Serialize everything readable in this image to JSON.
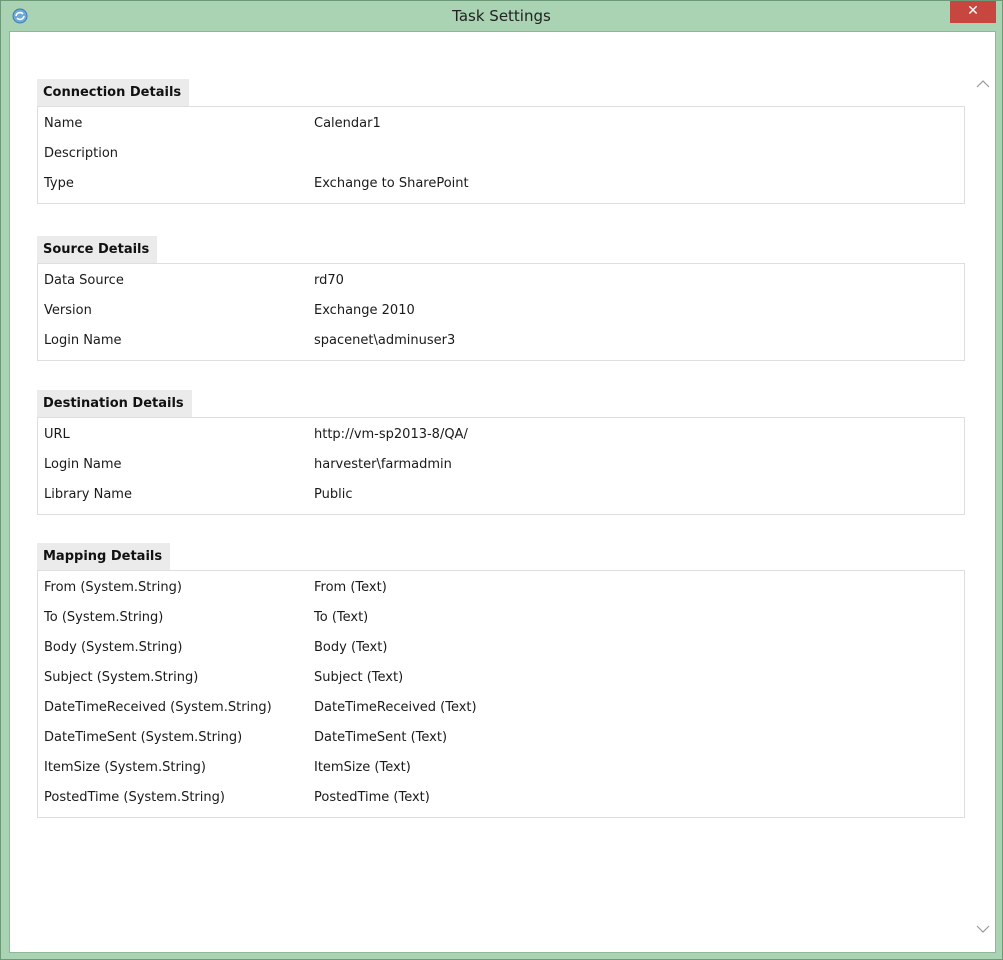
{
  "window": {
    "title": "Task Settings",
    "close_label": "✕"
  },
  "sections": {
    "connection": {
      "title": "Connection Details",
      "rows": [
        {
          "key": "Name",
          "value": "Calendar1"
        },
        {
          "key": "Description",
          "value": ""
        },
        {
          "key": "Type",
          "value": "Exchange to SharePoint"
        }
      ]
    },
    "source": {
      "title": "Source Details",
      "rows": [
        {
          "key": "Data Source",
          "value": "rd70"
        },
        {
          "key": "Version",
          "value": "Exchange 2010"
        },
        {
          "key": "Login Name",
          "value": "spacenet\\adminuser3"
        }
      ]
    },
    "destination": {
      "title": "Destination Details",
      "rows": [
        {
          "key": "URL",
          "value": "http://vm-sp2013-8/QA/"
        },
        {
          "key": "Login Name",
          "value": "harvester\\farmadmin"
        },
        {
          "key": "Library Name",
          "value": "Public"
        }
      ]
    },
    "mapping": {
      "title": "Mapping Details",
      "rows": [
        {
          "key": "From (System.String)",
          "value": "From (Text)"
        },
        {
          "key": "To (System.String)",
          "value": "To (Text)"
        },
        {
          "key": "Body (System.String)",
          "value": "Body (Text)"
        },
        {
          "key": "Subject (System.String)",
          "value": "Subject (Text)"
        },
        {
          "key": "DateTimeReceived (System.String)",
          "value": "DateTimeReceived (Text)"
        },
        {
          "key": "DateTimeSent (System.String)",
          "value": "DateTimeSent (Text)"
        },
        {
          "key": "ItemSize (System.String)",
          "value": "ItemSize (Text)"
        },
        {
          "key": "PostedTime (System.String)",
          "value": "PostedTime (Text)"
        }
      ]
    }
  },
  "colors": {
    "titlebar": "#a9d3b3",
    "close_button": "#c7463f",
    "section_header_bg": "#ebebeb"
  },
  "icons": {
    "app": "app-icon",
    "close": "close-icon",
    "scroll_up": "chevron-up-icon",
    "scroll_down": "chevron-down-icon"
  }
}
